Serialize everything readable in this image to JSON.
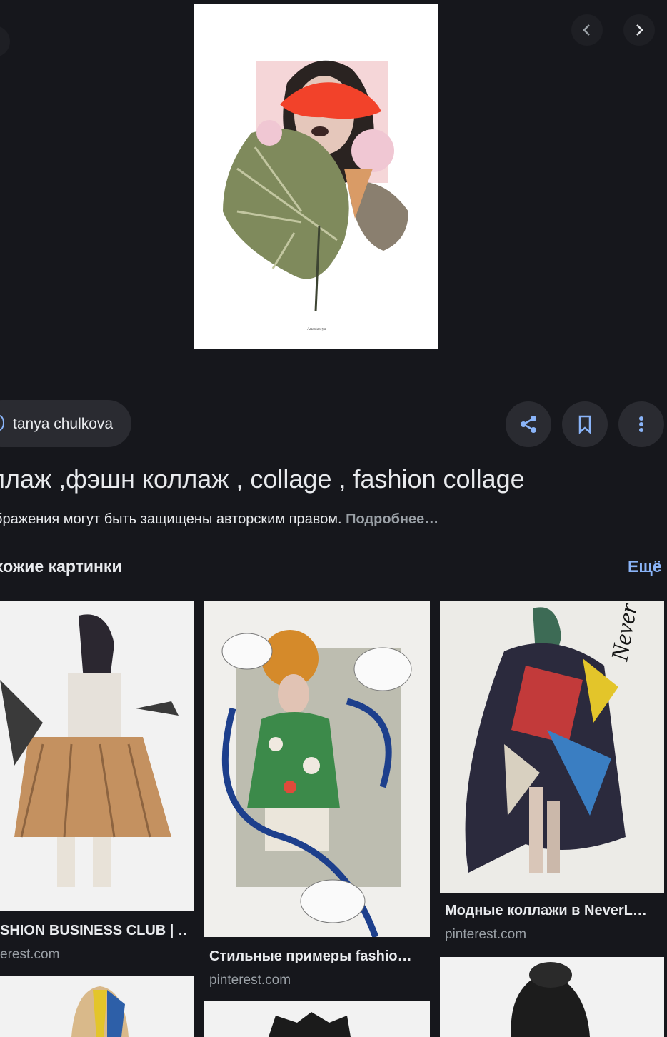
{
  "hero": {
    "signature": "Anastasiya"
  },
  "source_chip": {
    "label": "tanya chulkova"
  },
  "title": "ллаж ,фэшн коллаж , collage , fashion collage",
  "notice": {
    "text": "бражения могут быть защищены авторским правом.",
    "link": "Подробнее…"
  },
  "related": {
    "heading": "хожие картинки",
    "more_label": "Ещё",
    "items": [
      {
        "title": "SHION BUSINESS CLUB | …",
        "source": "erest.com"
      },
      {
        "title": "Стильные примеры fashio…",
        "source": "pinterest.com"
      },
      {
        "title": "Модные коллажи в NeverL…",
        "source": "pinterest.com"
      }
    ],
    "item3_overlay_text": "Never Lazy"
  },
  "colors": {
    "background": "#16171c",
    "accent": "#8ab4f8",
    "surface": "#2a2b31"
  }
}
